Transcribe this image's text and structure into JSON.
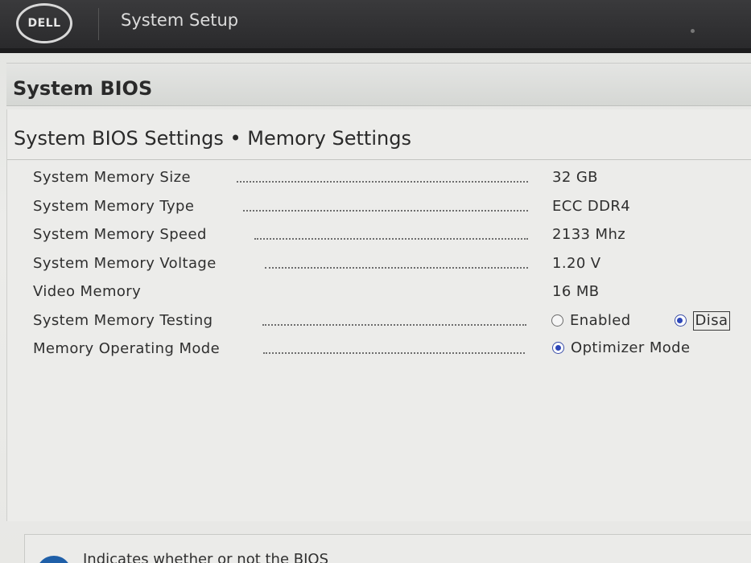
{
  "header": {
    "logo_text": "DELL",
    "app_title": "System Setup"
  },
  "section": {
    "title": "System BIOS"
  },
  "page": {
    "title": "System BIOS Settings • Memory Settings"
  },
  "settings": [
    {
      "label": "System Memory Size",
      "value": "32 GB"
    },
    {
      "label": "System Memory Type",
      "value": "ECC DDR4"
    },
    {
      "label": "System Memory Speed",
      "value": "2133 Mhz"
    },
    {
      "label": "System Memory Voltage",
      "value": "1.20 V"
    },
    {
      "label": "Video Memory",
      "value": "16 MB"
    },
    {
      "label": "System Memory Testing",
      "options": [
        {
          "label": "Enabled",
          "checked": false
        },
        {
          "label": "Disa",
          "checked": true
        }
      ]
    },
    {
      "label": "Memory Operating Mode",
      "options": [
        {
          "label": "Optimizer Mode",
          "checked": true
        }
      ]
    }
  ],
  "help": {
    "text": "Indicates whether or not the BIOS"
  },
  "colors": {
    "topbar": "#2e2e30",
    "radio_selected": "#2c46b8",
    "help_icon": "#1f5fa8"
  }
}
